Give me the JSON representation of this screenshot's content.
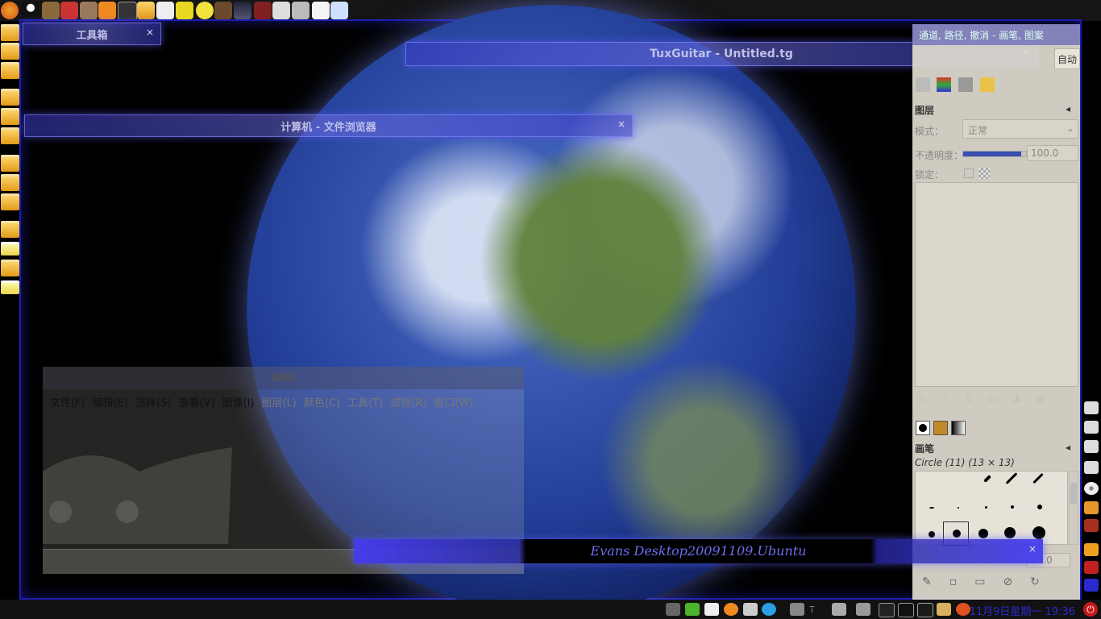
{
  "toolbox": {
    "title": "工具箱",
    "close": "×"
  },
  "tuxguitar": {
    "title": "TuxGuitar - Untitled.tg",
    "close": "×"
  },
  "filebrowser": {
    "title": "计算机 - 文件浏览器",
    "close": "×"
  },
  "gimp": {
    "title": "GNU",
    "menus": [
      {
        "label": "文件(F)",
        "dim": false
      },
      {
        "label": "编辑(E)",
        "dim": false
      },
      {
        "label": "选择(S)",
        "dim": false
      },
      {
        "label": "查看(V)",
        "dim": false
      },
      {
        "label": "图像(I)",
        "dim": false
      },
      {
        "label": "图层(L)",
        "dim": true
      },
      {
        "label": "颜色(C)",
        "dim": true
      },
      {
        "label": "工具(T)",
        "dim": true
      },
      {
        "label": "滤镜(R)",
        "dim": true
      },
      {
        "label": "窗口(W)",
        "dim": true
      }
    ]
  },
  "dock": {
    "title": "通道, 路径, 撤消 - 画笔, 图案",
    "auto_button": "自动",
    "layers_title": "图层",
    "mode_label": "模式：",
    "mode_value": "正常",
    "opacity_label": "不透明度：",
    "opacity_value": "100.0",
    "opacity_fraction": 0.92,
    "lock_label": "锁定：",
    "brushes_title": "画笔",
    "brush_name": "Circle (11) (13 × 13)",
    "spacing_value": "20.0"
  },
  "banner": {
    "text": "Evans Desktop20091109.Ubuntu",
    "close": "×"
  },
  "clock": {
    "text": "11月9日星期一 19:36"
  },
  "tray_text": "T"
}
